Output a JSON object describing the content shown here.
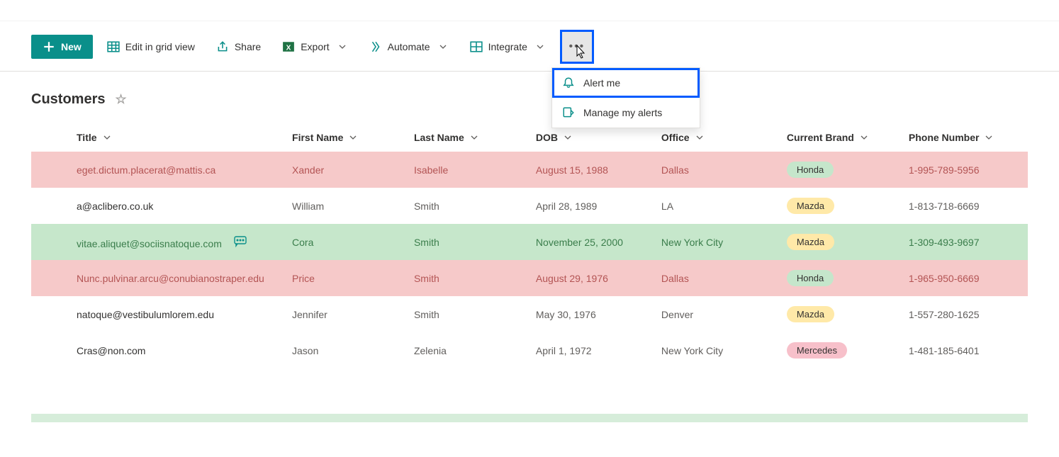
{
  "toolbar": {
    "new_label": "New",
    "edit_label": "Edit in grid view",
    "share_label": "Share",
    "export_label": "Export",
    "automate_label": "Automate",
    "integrate_label": "Integrate"
  },
  "dropdown": {
    "alert_label": "Alert me",
    "manage_label": "Manage my alerts"
  },
  "list": {
    "title": "Customers"
  },
  "columns": {
    "title": "Title",
    "first": "First Name",
    "last": "Last Name",
    "dob": "DOB",
    "office": "Office",
    "brand": "Current Brand",
    "phone": "Phone Number"
  },
  "rows": [
    {
      "title": "eget.dictum.placerat@mattis.ca",
      "first": "Xander",
      "last": "Isabelle",
      "dob": "August 15, 1988",
      "office": "Dallas",
      "brand": "Honda",
      "brand_chip": "green",
      "phone": "1-995-789-5956",
      "style": "pink",
      "comment": false
    },
    {
      "title": "a@aclibero.co.uk",
      "first": "William",
      "last": "Smith",
      "dob": "April 28, 1989",
      "office": "LA",
      "brand": "Mazda",
      "brand_chip": "yellow",
      "phone": "1-813-718-6669",
      "style": "plain",
      "comment": false
    },
    {
      "title": "vitae.aliquet@sociisnatoque.com",
      "first": "Cora",
      "last": "Smith",
      "dob": "November 25, 2000",
      "office": "New York City",
      "brand": "Mazda",
      "brand_chip": "yellow",
      "phone": "1-309-493-9697",
      "style": "green",
      "comment": true
    },
    {
      "title": "Nunc.pulvinar.arcu@conubianostraper.edu",
      "first": "Price",
      "last": "Smith",
      "dob": "August 29, 1976",
      "office": "Dallas",
      "brand": "Honda",
      "brand_chip": "green",
      "phone": "1-965-950-6669",
      "style": "pink",
      "comment": false
    },
    {
      "title": "natoque@vestibulumlorem.edu",
      "first": "Jennifer",
      "last": "Smith",
      "dob": "May 30, 1976",
      "office": "Denver",
      "brand": "Mazda",
      "brand_chip": "yellow",
      "phone": "1-557-280-1625",
      "style": "plain",
      "comment": false
    },
    {
      "title": "Cras@non.com",
      "first": "Jason",
      "last": "Zelenia",
      "dob": "April 1, 1972",
      "office": "New York City",
      "brand": "Mercedes",
      "brand_chip": "pink",
      "phone": "1-481-185-6401",
      "style": "plain",
      "comment": false
    }
  ]
}
